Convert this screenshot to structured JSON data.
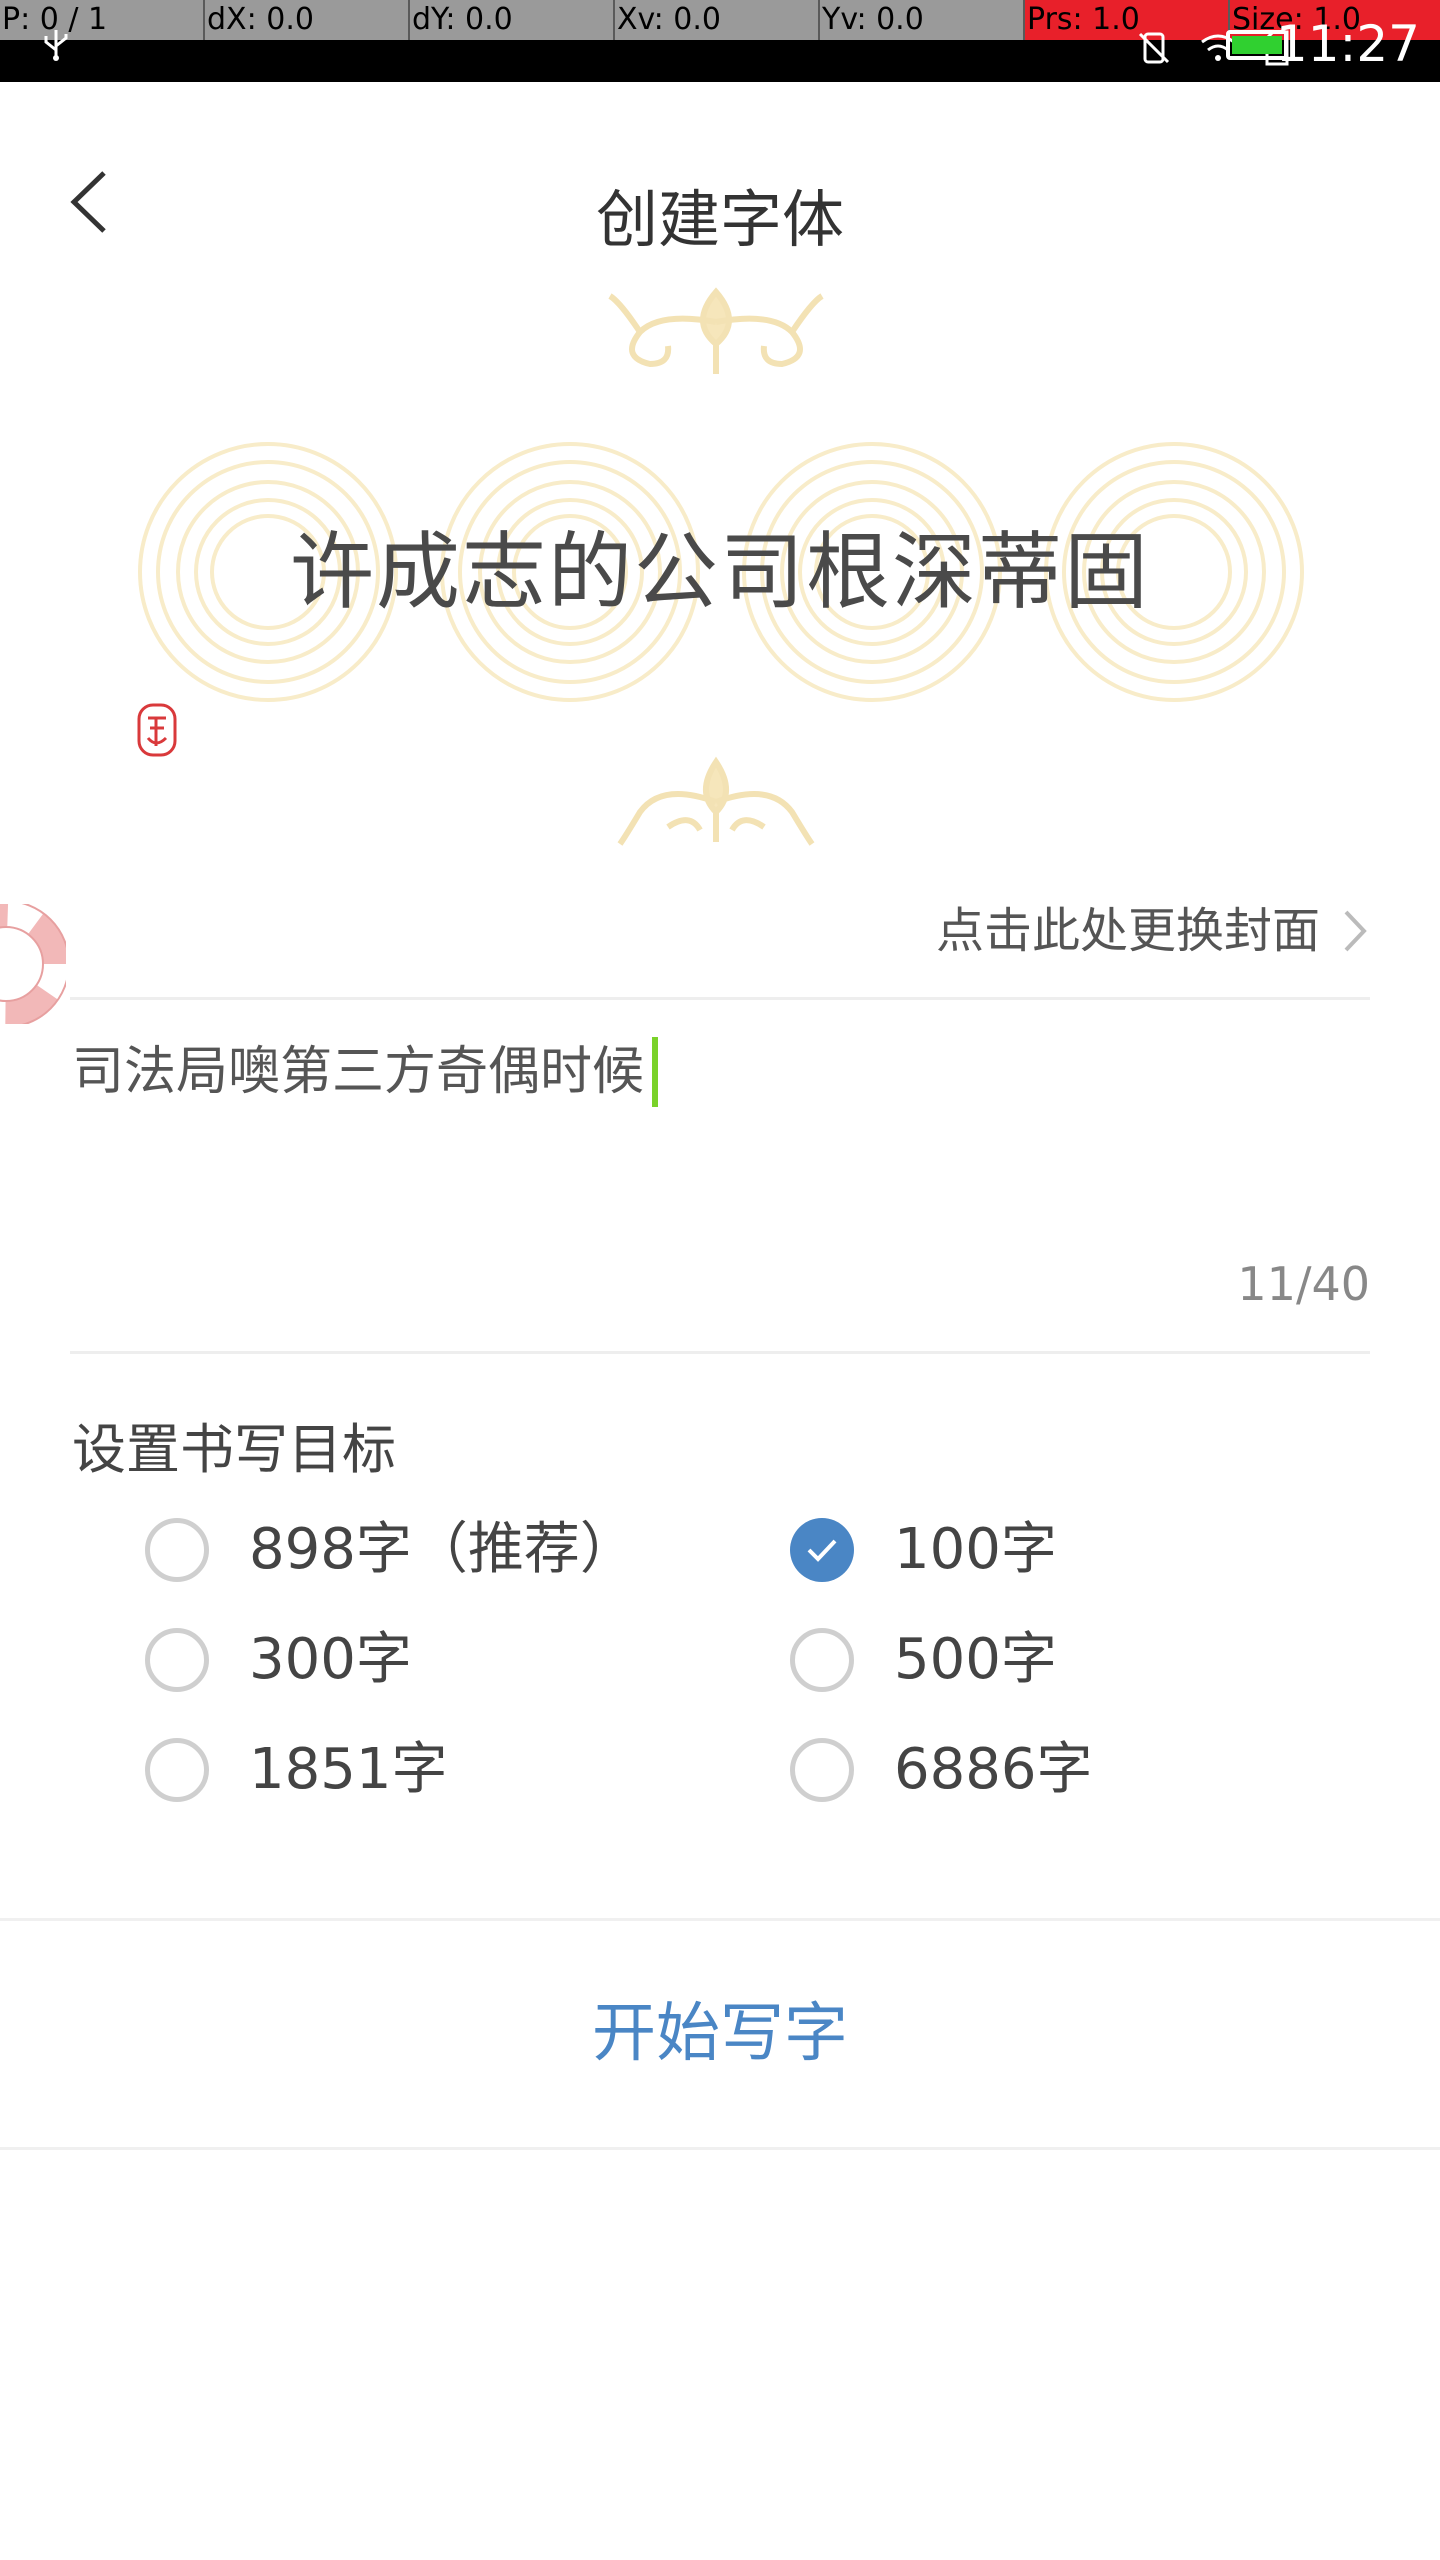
{
  "debug_bar": {
    "cells": [
      "P: 0 / 1",
      "dX: 0.0",
      "dY: 0.0",
      "Xv: 0.0",
      "Yv: 0.0",
      "Prs: 1.0",
      "Size: 1.0"
    ]
  },
  "status_bar": {
    "time": "11:27"
  },
  "header": {
    "title": "创建字体"
  },
  "cover": {
    "text": "许成志的公司根深蒂固",
    "change_cover_label": "点击此处更换封面"
  },
  "text_input": {
    "value": "司法局噢第三方奇偶时候",
    "counter": "11/40"
  },
  "goal": {
    "title": "设置书写目标",
    "options": [
      {
        "label": "898字（推荐）",
        "checked": false
      },
      {
        "label": "100字",
        "checked": true
      },
      {
        "label": "300字",
        "checked": false
      },
      {
        "label": "500字",
        "checked": false
      },
      {
        "label": "1851字",
        "checked": false
      },
      {
        "label": "6886字",
        "checked": false
      }
    ]
  },
  "start_button": {
    "label": "开始写字"
  },
  "colors": {
    "accent": "#4a86c5",
    "cursor": "#7ad22a",
    "decor": "#f6e6bb"
  }
}
